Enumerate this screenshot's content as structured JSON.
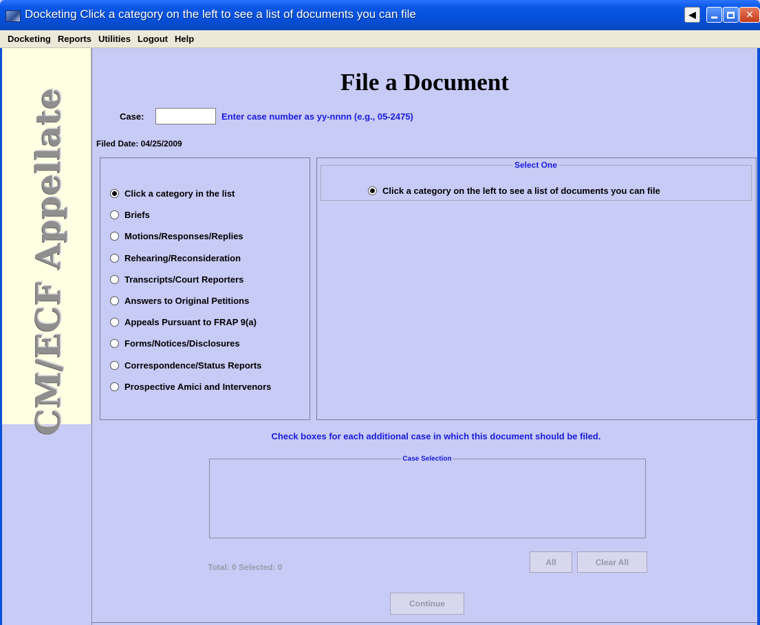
{
  "window": {
    "title": "Docketing Click a category on the left to see a list of documents you can file",
    "buttons": {
      "back": "◀",
      "minimize": "",
      "maximize": "",
      "close": "✕"
    }
  },
  "menu": [
    "Docketing",
    "Reports",
    "Utilities",
    "Logout",
    "Help"
  ],
  "banner": {
    "text": "CM/ECF Appellate"
  },
  "page": {
    "title": "File a Document",
    "case_label": "Case:",
    "case_value": "",
    "case_hint": "Enter case number as yy-nnnn (e.g., 05-2475)",
    "filed_date": "Filed Date: 04/25/2009"
  },
  "categories": [
    {
      "label": "Click a category in the list",
      "checked": true
    },
    {
      "label": "Briefs",
      "checked": false
    },
    {
      "label": "Motions/Responses/Replies",
      "checked": false
    },
    {
      "label": "Rehearing/Reconsideration",
      "checked": false
    },
    {
      "label": "Transcripts/Court Reporters",
      "checked": false
    },
    {
      "label": "Answers to Original Petitions",
      "checked": false
    },
    {
      "label": "Appeals Pursuant to FRAP 9(a)",
      "checked": false
    },
    {
      "label": "Forms/Notices/Disclosures",
      "checked": false
    },
    {
      "label": "Correspondence/Status Reports",
      "checked": false
    },
    {
      "label": "Prospective Amici and Intervenors",
      "checked": false
    }
  ],
  "documents": {
    "legend": "Select One",
    "option": "Click a category on the left to see a list of documents you can file"
  },
  "case_selection": {
    "hint": "Check boxes for each additional case in which this document should be filed.",
    "legend": "Case Selection",
    "totals": "Total: 0   Selected: 0",
    "all_label": "All",
    "clear_all_label": "Clear All"
  },
  "continue_label": "Continue",
  "colors": {
    "title_bar": "#0451dd",
    "background": "#c8cbf6",
    "banner": "#ffffe3",
    "link_text": "#1a1ae0"
  }
}
